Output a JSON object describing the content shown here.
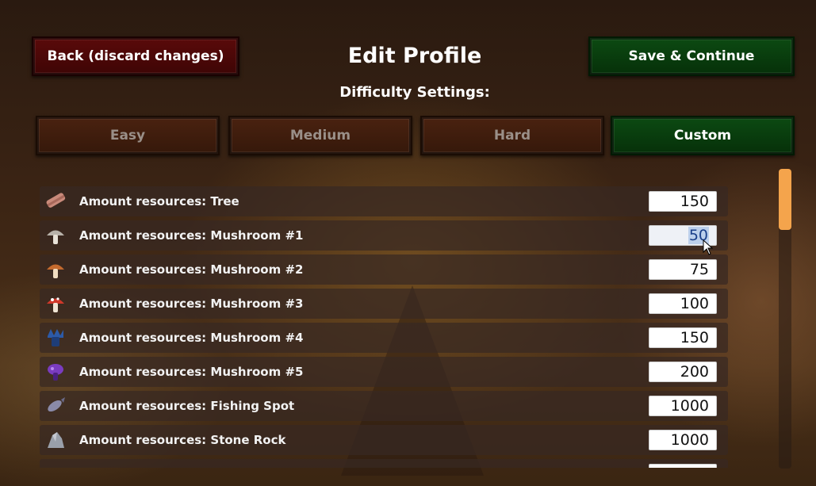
{
  "header": {
    "back_label": "Back (discard changes)",
    "title": "Edit Profile",
    "save_label": "Save & Continue",
    "subtitle": "Difficulty Settings:"
  },
  "difficulty": {
    "options": [
      "Easy",
      "Medium",
      "Hard",
      "Custom"
    ],
    "selected": "Custom"
  },
  "resources": {
    "rows": [
      {
        "label": "Amount resources: Tree",
        "value": "150",
        "icon": "wood-log-icon"
      },
      {
        "label": "Amount resources: Mushroom #1",
        "value": "50",
        "icon": "grey-mushroom-icon"
      },
      {
        "label": "Amount resources: Mushroom #2",
        "value": "75",
        "icon": "orange-mushroom-icon"
      },
      {
        "label": "Amount resources: Mushroom #3",
        "value": "100",
        "icon": "red-spotted-mushroom-icon"
      },
      {
        "label": "Amount resources: Mushroom #4",
        "value": "150",
        "icon": "blue-mushroom-icon"
      },
      {
        "label": "Amount resources: Mushroom #5",
        "value": "200",
        "icon": "purple-mushroom-icon"
      },
      {
        "label": "Amount resources: Fishing Spot",
        "value": "1000",
        "icon": "fish-icon"
      },
      {
        "label": "Amount resources: Stone Rock",
        "value": "1000",
        "icon": "stone-rock-icon"
      }
    ]
  },
  "colors": {
    "accent_green": "#0c4a12",
    "accent_red": "#5a0a0a",
    "scroll_thumb": "#f4a44c"
  }
}
